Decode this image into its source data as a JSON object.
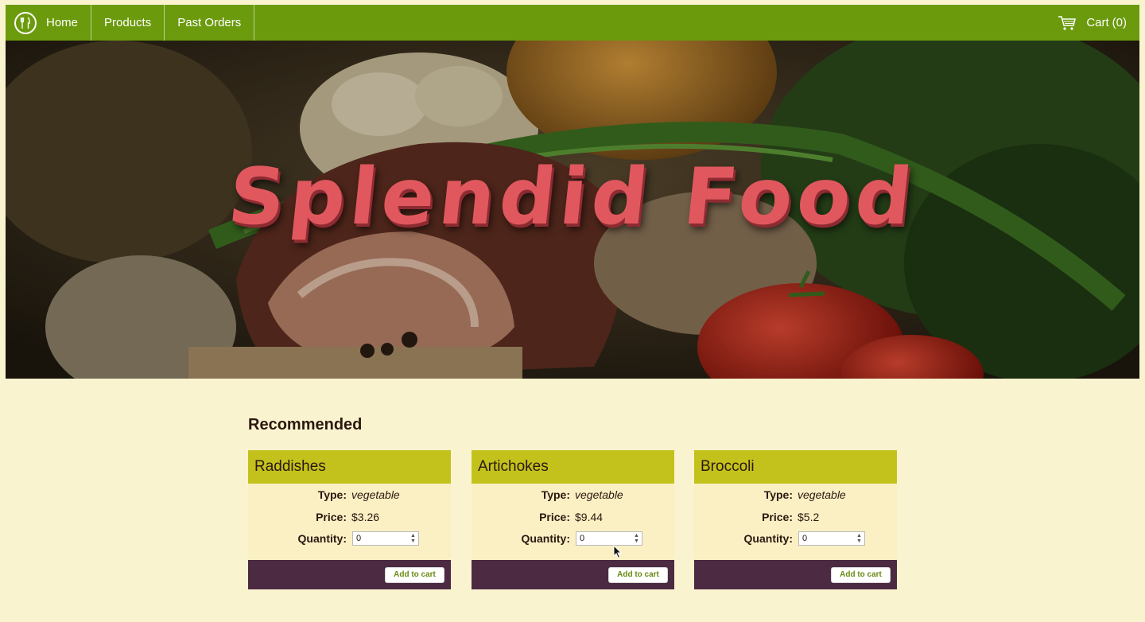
{
  "nav": {
    "logo_icon": "fork-knife-icon",
    "items": [
      {
        "label": "Home"
      },
      {
        "label": "Products"
      },
      {
        "label": "Past Orders"
      }
    ],
    "cart_icon": "shopping-cart-icon",
    "cart_label": "Cart",
    "cart_count": "(0)"
  },
  "hero": {
    "title": "Splendid Food"
  },
  "recommended": {
    "heading": "Recommended",
    "type_label": "Type:",
    "price_label": "Price:",
    "quantity_label": "Quantity:",
    "add_label": "Add to cart",
    "products": [
      {
        "name": "Raddishes",
        "type": "vegetable",
        "price": "$3.26",
        "quantity": "0"
      },
      {
        "name": "Artichokes",
        "type": "vegetable",
        "price": "$9.44",
        "quantity": "0"
      },
      {
        "name": "Broccoli",
        "type": "vegetable",
        "price": "$5.2",
        "quantity": "0"
      }
    ]
  },
  "colors": {
    "nav": "#6b9a0d",
    "card_header": "#c3c21c",
    "card_footer": "#4b2a42",
    "hero_title": "#e0585e",
    "page_bg": "#faf3cf"
  }
}
